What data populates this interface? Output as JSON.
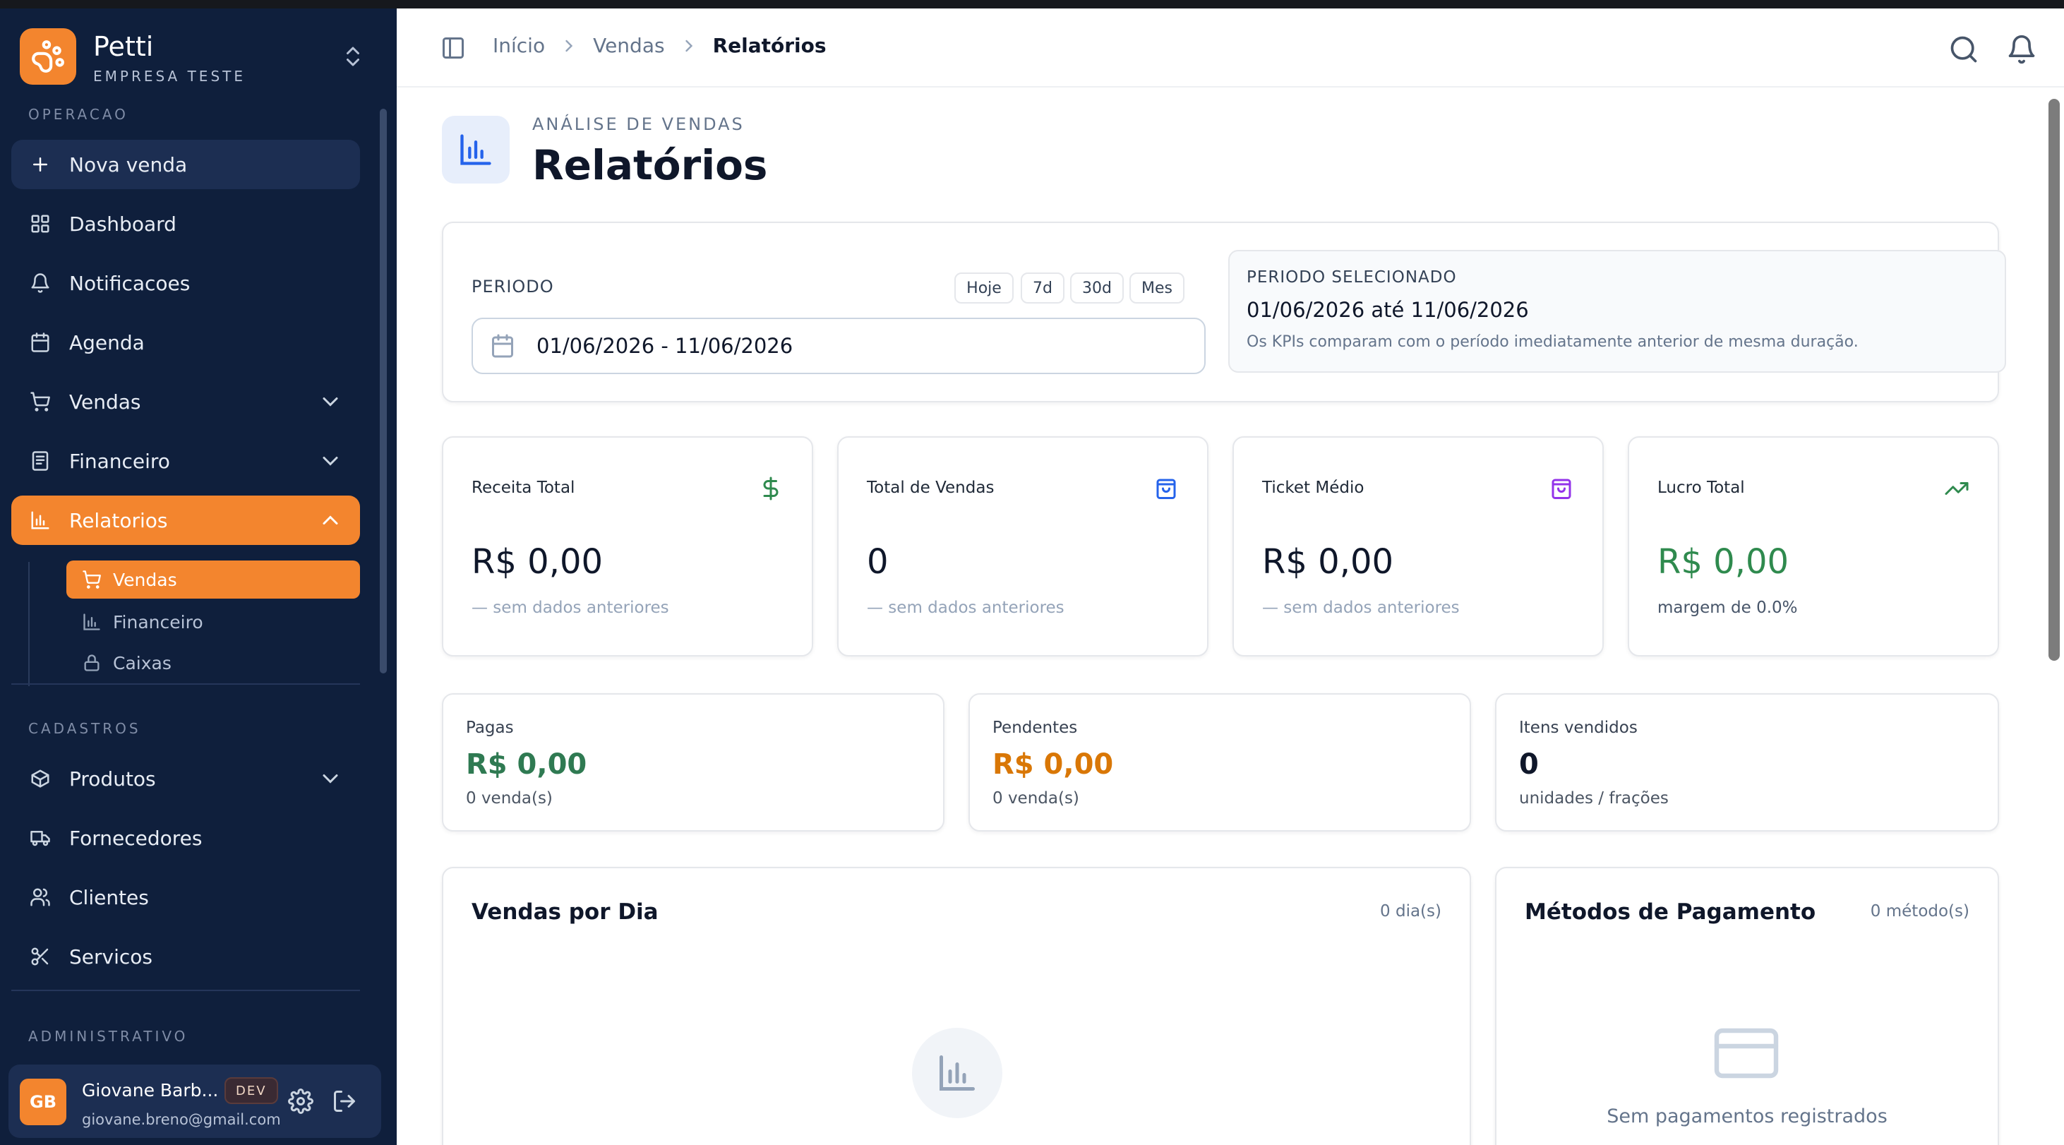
{
  "brand": {
    "name": "Petti",
    "subtitle": "EMPRESA TESTE"
  },
  "sidebar": {
    "sections": {
      "operacao": "OPERACAO",
      "cadastros": "CADASTROS",
      "administrativo": "ADMINISTRATIVO"
    },
    "items": {
      "nova_venda": "Nova venda",
      "dashboard": "Dashboard",
      "notificacoes": "Notificacoes",
      "agenda": "Agenda",
      "vendas": "Vendas",
      "financeiro": "Financeiro",
      "relatorios": "Relatorios",
      "produtos": "Produtos",
      "fornecedores": "Fornecedores",
      "clientes": "Clientes",
      "servicos": "Servicos"
    },
    "relatorios_sub": {
      "vendas": "Vendas",
      "financeiro": "Financeiro",
      "caixas": "Caixas"
    }
  },
  "user": {
    "initials": "GB",
    "name": "Giovane Barb...",
    "badge": "DEV",
    "email": "giovane.breno@gmail.com"
  },
  "breadcrumb": {
    "inicio": "Início",
    "vendas": "Vendas",
    "current": "Relatórios"
  },
  "header": {
    "eyebrow": "ANÁLISE DE VENDAS",
    "title": "Relatórios"
  },
  "period": {
    "label": "PERIODO",
    "chips": {
      "hoje": "Hoje",
      "d7": "7d",
      "d30": "30d",
      "mes": "Mes"
    },
    "value": "01/06/2026 - 11/06/2026",
    "selected_label": "PERIODO SELECIONADO",
    "selected_value": "01/06/2026 até 11/06/2026",
    "selected_note": "Os KPIs comparam com o período imediatamente anterior de mesma duração."
  },
  "kpis": {
    "receita": {
      "label": "Receita Total",
      "value": "R$ 0,00",
      "sub": "— sem dados anteriores"
    },
    "vendas": {
      "label": "Total de Vendas",
      "value": "0",
      "sub": "— sem dados anteriores"
    },
    "ticket": {
      "label": "Ticket Médio",
      "value": "R$ 0,00",
      "sub": "— sem dados anteriores"
    },
    "lucro": {
      "label": "Lucro Total",
      "value": "R$ 0,00",
      "sub": "margem de 0.0%"
    }
  },
  "stats": {
    "pagas": {
      "label": "Pagas",
      "value": "R$ 0,00",
      "sub": "0 venda(s)"
    },
    "pendentes": {
      "label": "Pendentes",
      "value": "R$ 0,00",
      "sub": "0 venda(s)"
    },
    "itens": {
      "label": "Itens vendidos",
      "value": "0",
      "sub": "unidades / frações"
    }
  },
  "panels": {
    "vendas_dia": {
      "title": "Vendas por Dia",
      "count": "0 dia(s)"
    },
    "metodos": {
      "title": "Métodos de Pagamento",
      "count": "0 método(s)",
      "empty": "Sem pagamentos registrados"
    }
  },
  "colors": {
    "accent": "#f3852e",
    "sidebar": "#0f1f3c",
    "green": "#2f8a4e",
    "orange": "#d97706",
    "blue": "#2563eb",
    "purple": "#9333ea"
  }
}
